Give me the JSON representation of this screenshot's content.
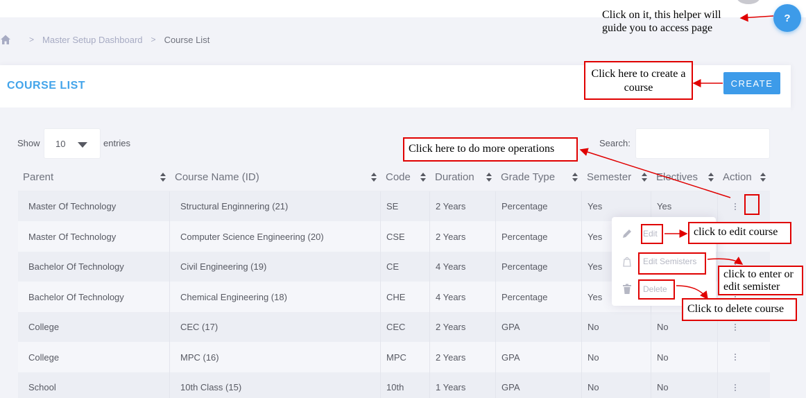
{
  "help": {
    "icon_label": "?"
  },
  "breadcrumb": {
    "items": [
      "Master Setup Dashboard",
      "Course List"
    ]
  },
  "page": {
    "title": "COURSE LIST",
    "create_label": "CREATE"
  },
  "controls": {
    "show_label": "Show",
    "entries_value": "10",
    "entries_label": "entries",
    "search_label": "Search:",
    "search_value": ""
  },
  "table": {
    "headers": [
      "Parent",
      "Course Name (ID)",
      "Code",
      "Duration",
      "Grade Type",
      "Semester",
      "Electives",
      "Action"
    ],
    "rows": [
      [
        "Master Of Technology",
        "Structural Enginnering (21)",
        "SE",
        "2 Years",
        "Percentage",
        "Yes",
        "Yes"
      ],
      [
        "Master Of Technology",
        "Computer Science Engineering (20)",
        "CSE",
        "2 Years",
        "Percentage",
        "Yes",
        ""
      ],
      [
        "Bachelor Of Technology",
        "Civil Engineering (19)",
        "CE",
        "4 Years",
        "Percentage",
        "Yes",
        ""
      ],
      [
        "Bachelor Of Technology",
        "Chemical Engineering (18)",
        "CHE",
        "4 Years",
        "Percentage",
        "Yes",
        ""
      ],
      [
        "College",
        "CEC (17)",
        "CEC",
        "2 Years",
        "GPA",
        "No",
        "No"
      ],
      [
        "College",
        "MPC (16)",
        "MPC",
        "2 Years",
        "GPA",
        "No",
        "No"
      ],
      [
        "School",
        "10th Class (15)",
        "10th",
        "1 Years",
        "GPA",
        "No",
        "No"
      ]
    ]
  },
  "action_menu": {
    "items": [
      "Edit",
      "Edit Semisters",
      "Delete"
    ]
  },
  "annotations": {
    "helper": "Click on it, this helper will guide you to access page",
    "create": "Click here to create a course",
    "operations": "Click here to do more operations",
    "edit": "click to edit course",
    "semesters": "click to enter or edit semister",
    "delete": "Click to delete course"
  },
  "colors": {
    "accent": "#3d9be9",
    "title": "#43a4ea",
    "annotation": "#e00000"
  }
}
